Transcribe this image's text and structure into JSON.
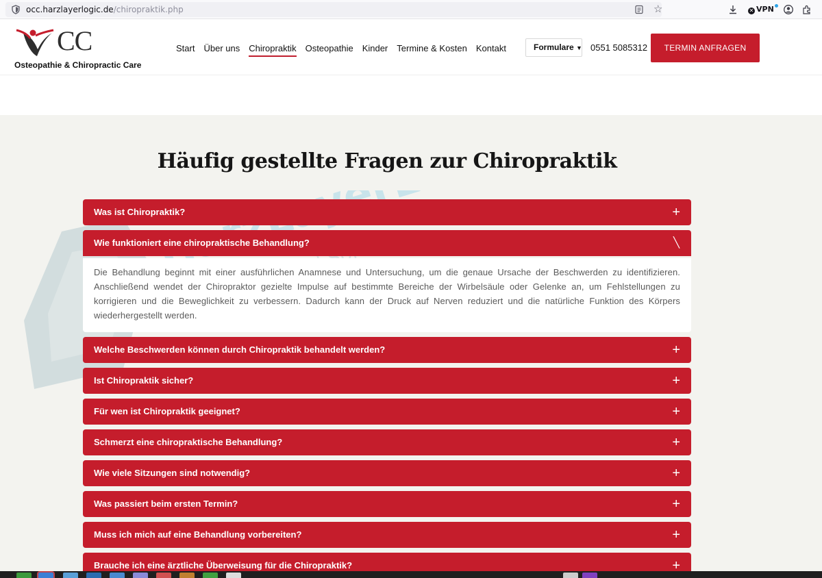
{
  "browser": {
    "url_host": "occ.harzlayerlogic.de",
    "url_path": "/chiropraktik.php",
    "vpn_label": "VPN"
  },
  "site": {
    "logo_text": "CC",
    "tagline": "Osteopathie & Chiropractic Care",
    "nav": [
      "Start",
      "Über uns",
      "Chiropraktik",
      "Osteopathie",
      "Kinder",
      "Termine & Kosten",
      "Kontakt"
    ],
    "active_nav": "Chiropraktik",
    "formulare_label": "Formulare",
    "phone": "0551 5085312",
    "cta_label": "TERMIN ANFRAGEN",
    "accent_color": "#c51d2c"
  },
  "watermark": {
    "line1": "HarzLayerLogic",
    "line2": "Smart | Home | Solutions"
  },
  "faq": {
    "title": "Häufig gestellte Fragen zur Chiropraktik",
    "items": [
      {
        "question": "Was ist Chiropraktik?",
        "open": false
      },
      {
        "question": "Wie funktioniert eine chiropraktische Behandlung?",
        "open": true
      },
      {
        "question": "Welche Beschwerden können durch Chiropraktik behandelt werden?",
        "open": false
      },
      {
        "question": "Ist Chiropraktik sicher?",
        "open": false
      },
      {
        "question": "Für wen ist Chiropraktik geeignet?",
        "open": false
      },
      {
        "question": "Schmerzt eine chiropraktische Behandlung?",
        "open": false
      },
      {
        "question": "Wie viele Sitzungen sind notwendig?",
        "open": false
      },
      {
        "question": "Was passiert beim ersten Termin?",
        "open": false
      },
      {
        "question": "Muss ich mich auf eine Behandlung vorbereiten?",
        "open": false
      },
      {
        "question": "Brauche ich eine ärztliche Überweisung für die Chiropraktik?",
        "open": false
      }
    ],
    "open_answer": "Die Behandlung beginnt mit einer ausführlichen Anamnese und Untersuchung, um die genaue Ursache der Beschwerden zu identifizieren. Anschließend wendet der Chiropraktor gezielte Impulse auf bestimmte Bereiche der Wirbelsäule oder Gelenke an, um Fehlstellungen zu korrigieren und die Beweglichkeit zu verbessern. Dadurch kann der Druck auf Nerven reduziert und die natürliche Funktion des Körpers wiederhergestellt werden."
  }
}
